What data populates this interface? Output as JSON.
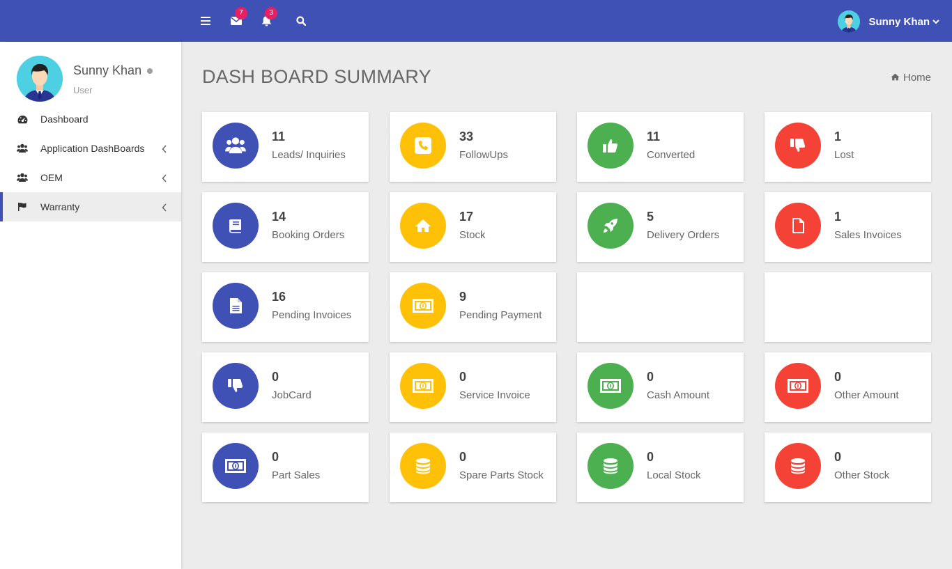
{
  "topbar": {
    "messages_badge": "7",
    "notifications_badge": "3",
    "user_name": "Sunny Khan"
  },
  "sidebar": {
    "profile": {
      "name": "Sunny Khan",
      "role": "User"
    },
    "items": [
      {
        "label": "Dashboard",
        "icon": "dashboard-icon"
      },
      {
        "label": "Application DashBoards",
        "icon": "users-icon"
      },
      {
        "label": "OEM",
        "icon": "users-icon"
      },
      {
        "label": "Warranty",
        "icon": "flag-icon",
        "active": true
      }
    ]
  },
  "main": {
    "title": "DASH BOARD SUMMARY",
    "breadcrumb": "Home",
    "cards": [
      {
        "value": "11",
        "label": "Leads/ Inquiries",
        "color": "blue",
        "icon": "users-icon"
      },
      {
        "value": "33",
        "label": "FollowUps",
        "color": "yellow",
        "icon": "phone-icon"
      },
      {
        "value": "11",
        "label": "Converted",
        "color": "green",
        "icon": "thumbs-up-icon"
      },
      {
        "value": "1",
        "label": "Lost",
        "color": "red",
        "icon": "thumbs-down-icon"
      },
      {
        "value": "14",
        "label": "Booking Orders",
        "color": "blue",
        "icon": "book-icon"
      },
      {
        "value": "17",
        "label": "Stock",
        "color": "yellow",
        "icon": "home-icon"
      },
      {
        "value": "5",
        "label": "Delivery Orders",
        "color": "green",
        "icon": "rocket-icon"
      },
      {
        "value": "1",
        "label": "Sales Invoices",
        "color": "red",
        "icon": "file-icon"
      },
      {
        "value": "16",
        "label": "Pending Invoices",
        "color": "blue",
        "icon": "file-text-icon"
      },
      {
        "value": "9",
        "label": "Pending Payment",
        "color": "yellow",
        "icon": "money-icon"
      },
      {
        "value": "0",
        "label": "JobCard",
        "color": "blue",
        "icon": "thumbs-down-icon"
      },
      {
        "value": "0",
        "label": "Service Invoice",
        "color": "yellow",
        "icon": "money-icon"
      },
      {
        "value": "0",
        "label": "Cash Amount",
        "color": "green",
        "icon": "money-icon"
      },
      {
        "value": "0",
        "label": "Other Amount",
        "color": "red",
        "icon": "money-icon"
      },
      {
        "value": "0",
        "label": "Part Sales",
        "color": "blue",
        "icon": "money-icon"
      },
      {
        "value": "0",
        "label": "Spare Parts Stock",
        "color": "yellow",
        "icon": "database-icon"
      },
      {
        "value": "0",
        "label": "Local Stock",
        "color": "green",
        "icon": "database-icon"
      },
      {
        "value": "0",
        "label": "Other Stock",
        "color": "red",
        "icon": "database-icon"
      }
    ]
  },
  "colors": {
    "primary": "#3f51b5",
    "yellow": "#ffc107",
    "green": "#4caf50",
    "red": "#f44336",
    "badge": "#e91e63"
  }
}
